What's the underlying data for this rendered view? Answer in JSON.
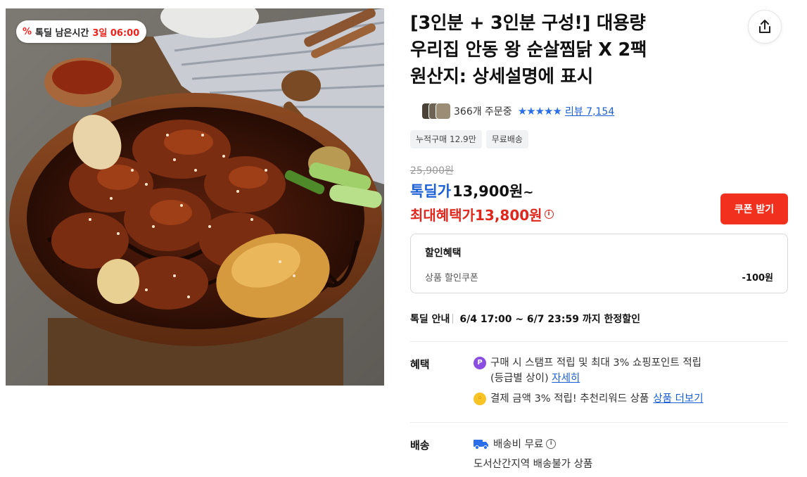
{
  "image": {
    "badge": {
      "icon": "percent-tag-icon",
      "label": "톡딜 남은시간",
      "time": "3일 06:00"
    }
  },
  "product": {
    "title_lines": [
      "[3인분 + 3인분 구성!] 대용량",
      "우리집 안동 왕 순살찜닭 X 2팩",
      "원산지: 상세설명에 표시"
    ],
    "order_count": "366개 주문중",
    "stars": "★★★★★",
    "review_link": "리뷰 7,154",
    "tags": [
      "누적구매 12.9만",
      "무료배송"
    ]
  },
  "price": {
    "original": "25,900원",
    "deal_label": "톡딜가",
    "deal_value": "13,900원",
    "deal_suffix": "~",
    "max_label": "최대혜택가",
    "max_value": "13,800원",
    "coupon_button": "쿠폰 받기"
  },
  "discount": {
    "title": "할인혜택",
    "row_label": "상품 할인쿠폰",
    "row_value": "-100원"
  },
  "deal_info": {
    "label": "톡딜 안내",
    "text": "6/4 17:00 ~ 6/7 23:59 까지 한정할인"
  },
  "benefit": {
    "label": "혜택",
    "item1_text": "구매 시 스탬프 적립 및 최대 3% 쇼핑포인트 적립",
    "item1_text2": "(등급별 상이)",
    "item1_link": "자세히",
    "item2_text": "결제 금액 3% 적립! 추천리워드 상품",
    "item2_link": "상품 더보기"
  },
  "shipping": {
    "label": "배송",
    "fee": "배송비 무료",
    "note": "도서산간지역 배송불가 상품"
  },
  "colors": {
    "accent_red": "#f2301e",
    "accent_blue": "#1a5fd6"
  }
}
